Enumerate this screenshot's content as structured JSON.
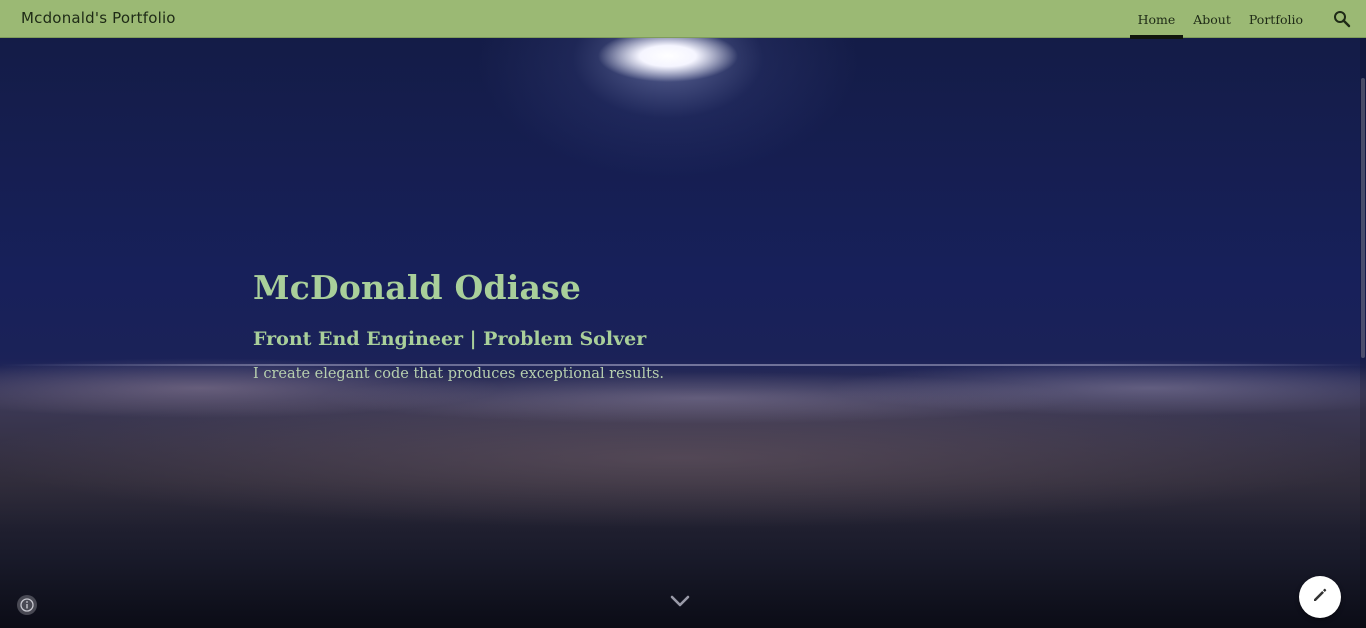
{
  "header": {
    "site_title": "Mcdonald's Portfolio",
    "nav": [
      {
        "label": "Home",
        "active": true
      },
      {
        "label": "About",
        "active": false
      },
      {
        "label": "Portfolio",
        "active": false
      }
    ],
    "search_icon": "search-icon",
    "bar_color": "#9bb974"
  },
  "hero": {
    "title": "McDonald Odiase",
    "subtitle": "Front End Engineer | Problem Solver",
    "tagline": "I create elegant code that produces exceptional results.",
    "text_color": "#a9cf9a"
  },
  "controls": {
    "scroll_icon": "chevron-down-icon",
    "info_icon": "info-icon",
    "edit_icon": "pencil-icon"
  }
}
